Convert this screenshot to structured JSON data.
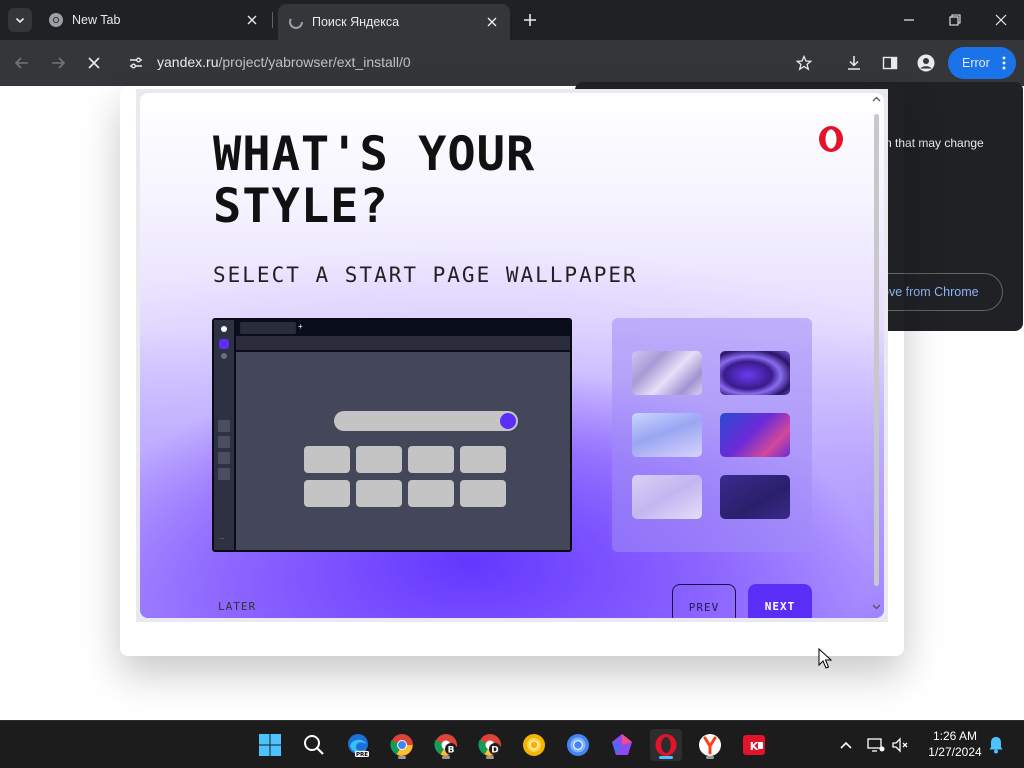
{
  "browser": {
    "tabs": [
      {
        "title": "New Tab",
        "active": false
      },
      {
        "title": "Поиск Яндекса",
        "active": true
      }
    ],
    "url": {
      "domain": "yandex.ru",
      "path": "/project/yabrowser/ext_install/0"
    },
    "error_button_label": "Error"
  },
  "extension_popup": {
    "partial_text": "n that may change",
    "remove_button_label": "ove from Chrome"
  },
  "dialog": {
    "title_line1": "WHAT'S YOUR",
    "title_line2": "STYLE?",
    "subtitle": "SELECT A START PAGE WALLPAPER",
    "later_label": "LATER",
    "prev_label": "PREV",
    "next_label": "NEXT",
    "preview": {
      "search_button_glyph": "o",
      "sidebar_dots": "..."
    },
    "wallpapers": [
      {
        "name": "silver-waves"
      },
      {
        "name": "purple-swirl"
      },
      {
        "name": "blue-mist"
      },
      {
        "name": "aurora"
      },
      {
        "name": "lavender"
      },
      {
        "name": "deep-indigo"
      }
    ],
    "colors": {
      "accent": "#5b2ef7",
      "opera_red": "#e3132c"
    }
  },
  "taskbar": {
    "apps": [
      "start",
      "search",
      "edge-beta",
      "chrome",
      "chrome-b",
      "chrome-d",
      "chrome-canary",
      "chromium",
      "kiwi",
      "opera",
      "yandex",
      "kaspersky"
    ],
    "active_app": "opera",
    "clock": {
      "time": "1:26 AM",
      "date": "1/27/2024"
    }
  }
}
